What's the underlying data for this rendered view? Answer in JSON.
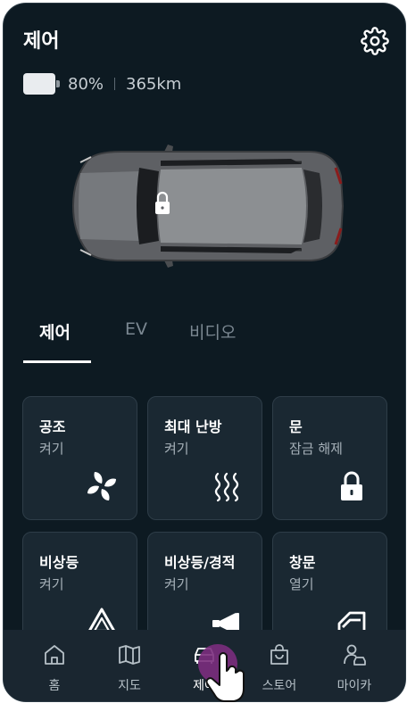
{
  "header": {
    "title": "제어",
    "settings_icon": "gear-icon"
  },
  "status": {
    "battery_percent": "80%",
    "range": "365km",
    "battery_level": 0.8
  },
  "vehicle": {
    "lock_icon": "lock-icon"
  },
  "tabs": [
    {
      "label": "제어",
      "active": true
    },
    {
      "label": "EV",
      "active": false
    },
    {
      "label": "비디오",
      "active": false
    }
  ],
  "controls": [
    {
      "title": "공조",
      "status": "켜기",
      "icon": "fan-icon"
    },
    {
      "title": "최대 난방",
      "status": "켜기",
      "icon": "heat-icon"
    },
    {
      "title": "문",
      "status": "잠금 해제",
      "icon": "lock-icon"
    },
    {
      "title": "비상등",
      "status": "켜기",
      "icon": "hazard-icon"
    },
    {
      "title": "비상등/경적",
      "status": "켜기",
      "icon": "horn-icon"
    },
    {
      "title": "창문",
      "status": "열기",
      "icon": "window-icon"
    }
  ],
  "navbar": {
    "items": [
      {
        "label": "홈",
        "icon": "home-icon",
        "active": false
      },
      {
        "label": "지도",
        "icon": "map-icon",
        "active": false
      },
      {
        "label": "제어",
        "icon": "car-icon",
        "active": true
      },
      {
        "label": "스토어",
        "icon": "shopping-bag-icon",
        "active": false
      },
      {
        "label": "마이카",
        "icon": "profile-car-icon",
        "active": false
      }
    ]
  },
  "colors": {
    "background": "#0d1a22",
    "card": "#1a2832",
    "navbar": "#1a2630",
    "touch_indicator": "#7b2d7e"
  }
}
